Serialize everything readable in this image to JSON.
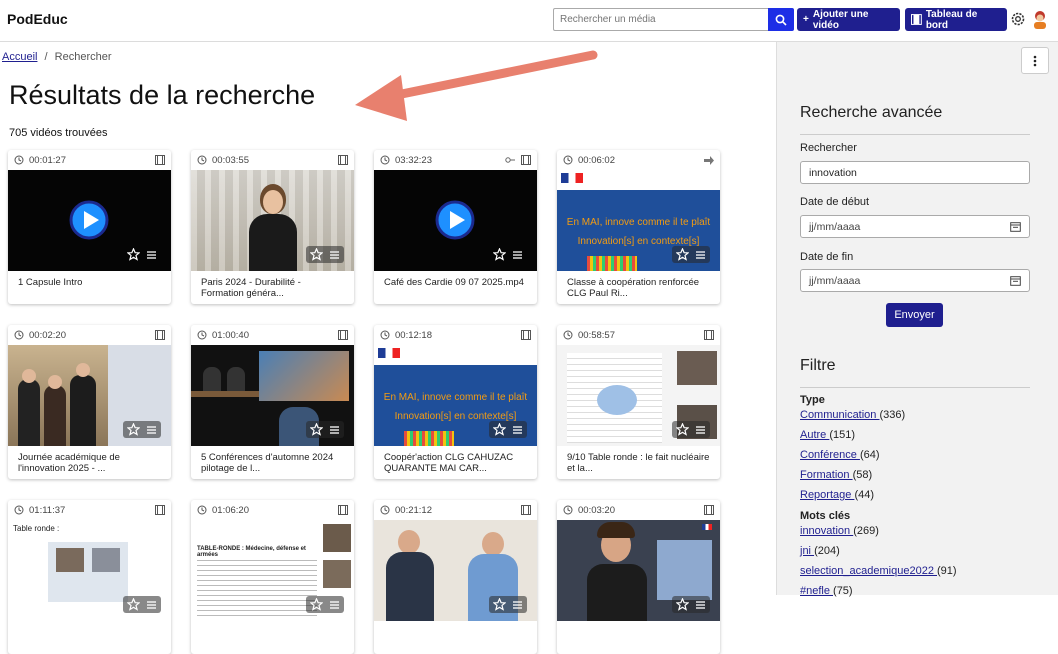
{
  "header": {
    "brand": "PodEduc",
    "search_placeholder": "Rechercher un média",
    "add_video_label": "Ajouter une vidéo",
    "dashboard_label": "Tableau de bord",
    "icons": [
      "search-icon",
      "plus-icon",
      "film-icon",
      "gear-icon",
      "avatar"
    ]
  },
  "breadcrumb": {
    "home": "Accueil",
    "separator": "/",
    "current": "Rechercher"
  },
  "main": {
    "title": "Résultats de la recherche",
    "count": "705 vidéos trouvées"
  },
  "videos": [
    {
      "duration": "00:01:27",
      "title": "1 Capsule Intro",
      "thumb": "play"
    },
    {
      "duration": "00:03:55",
      "title": "Paris 2024 - Durabilité - Formation généra...",
      "thumb": "person-hall"
    },
    {
      "duration": "03:32:23",
      "title": "Café des Cardie 09 07 2025.mp4",
      "thumb": "play"
    },
    {
      "duration": "00:06:02",
      "title": "Classe à coopération renforcée CLG Paul Ri...",
      "thumb": "innov"
    },
    {
      "duration": "00:02:20",
      "title": "Journée académique de l'innovation 2025 - ...",
      "thumb": "group"
    },
    {
      "duration": "01:00:40",
      "title": "5 Conférences d'automne 2024 pilotage de l...",
      "thumb": "conference"
    },
    {
      "duration": "00:12:18",
      "title": "Coopér'action CLG CAHUZAC QUARANTE MAI CAR...",
      "thumb": "innov"
    },
    {
      "duration": "00:58:57",
      "title": "9/10 Table ronde : le fait nucléaire et la...",
      "thumb": "doc"
    },
    {
      "duration": "01:11:37",
      "title": "",
      "thumb": "table-ronde"
    },
    {
      "duration": "01:06:20",
      "title": "",
      "thumb": "text-doc"
    },
    {
      "duration": "00:21:12",
      "title": "",
      "thumb": "two-men"
    },
    {
      "duration": "00:03:20",
      "title": "",
      "thumb": "student"
    }
  ],
  "video_overlay_text": {
    "innov_line1": "En MAI, innove comme il te plaît",
    "innov_line2": "Innovation[s] en contexte[s]",
    "table_ronde": "Table ronde :",
    "text_doc_head": "TABLE-RONDE : Médecine, défense et armées"
  },
  "sidebar": {
    "advanced_title": "Recherche avancée",
    "search_label": "Rechercher",
    "search_value": "innovation",
    "start_label": "Date de début",
    "start_placeholder": "jj/mm/aaaa",
    "end_label": "Date de fin",
    "end_placeholder": "jj/mm/aaaa",
    "submit_label": "Envoyer",
    "filter_title": "Filtre",
    "type_label": "Type",
    "types": [
      {
        "label": "Communication ",
        "count": "(336)"
      },
      {
        "label": "Autre ",
        "count": "(151)"
      },
      {
        "label": "Conférence ",
        "count": "(64)"
      },
      {
        "label": "Formation ",
        "count": "(58)"
      },
      {
        "label": "Reportage ",
        "count": "(44)"
      }
    ],
    "tags_label": "Mots clés",
    "tags": [
      {
        "label": "innovation ",
        "count": "(269)"
      },
      {
        "label": "jni ",
        "count": "(204)"
      },
      {
        "label": "selection_academique2022 ",
        "count": "(91)"
      },
      {
        "label": "#nefle ",
        "count": "(75)"
      }
    ]
  },
  "colors": {
    "navy": "#1f1f8f",
    "blue": "#1d2ee6",
    "sidebar_bg": "#f2f2f2",
    "annotation_arrow": "#e8806e"
  }
}
